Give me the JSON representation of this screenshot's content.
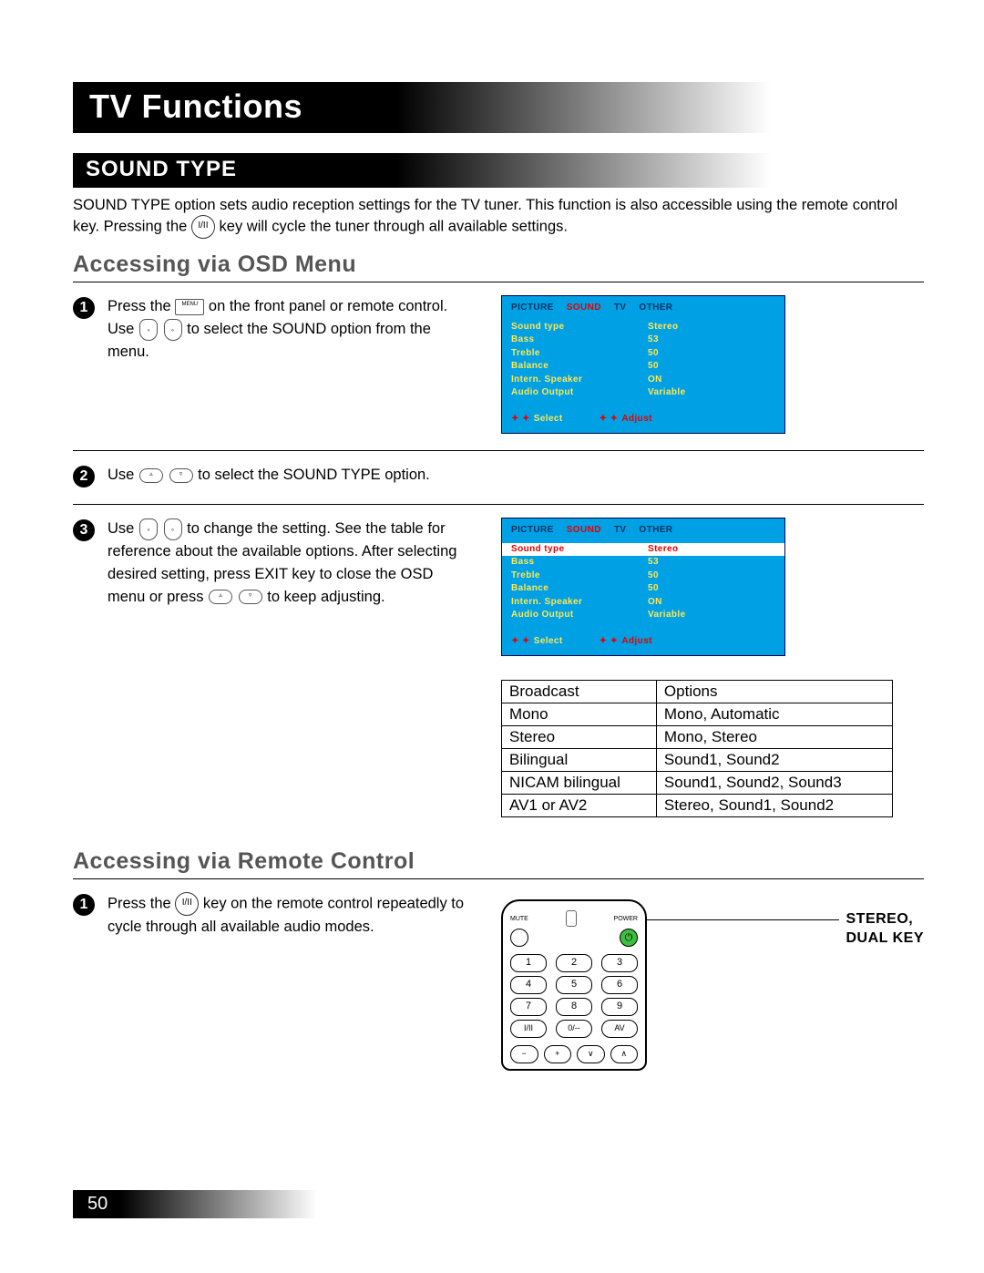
{
  "page_number": "50",
  "title": "TV Functions",
  "section": "SOUND TYPE",
  "intro_a": "SOUND TYPE option sets audio reception settings for the TV tuner.  This function is also accessible using the remote control key.  Pressing the ",
  "intro_key": "I/II",
  "intro_b": " key will cycle the tuner through all available settings.",
  "h2_osd": "Accessing via OSD Menu",
  "h2_remote": "Accessing via Remote Control",
  "steps": {
    "s1": {
      "n": "1",
      "a": "Press the ",
      "b": " on the front panel or remote control.  Use ",
      "c": " to select the SOUND option from the menu."
    },
    "s2": {
      "n": "2",
      "a": "Use ",
      "b": " to select the SOUND TYPE option."
    },
    "s3": {
      "n": "3",
      "a": "Use ",
      "b": " to change the setting.  See the table for reference about the available options.  After selecting desired setting, press EXIT key to close the OSD menu or press ",
      "c": " to keep adjusting."
    },
    "r1": {
      "n": "1",
      "a": "Press the ",
      "b": " key on the remote control repeatedly to cycle through all available audio modes."
    }
  },
  "osd": {
    "tabs": [
      "PICTURE",
      "SOUND",
      "TV",
      "OTHER"
    ],
    "active_tab": "SOUND",
    "rows": [
      {
        "k": "Sound type",
        "v": "Stereo"
      },
      {
        "k": "Bass",
        "v": "53"
      },
      {
        "k": "Treble",
        "v": "50"
      },
      {
        "k": "Balance",
        "v": "50"
      },
      {
        "k": "Intern. Speaker",
        "v": "ON"
      },
      {
        "k": "Audio Output",
        "v": "Variable"
      }
    ],
    "foot_select": "Select",
    "foot_adjust": "Adjust"
  },
  "ref_table": [
    [
      "Broadcast",
      "Options"
    ],
    [
      "Mono",
      "Mono, Automatic"
    ],
    [
      "Stereo",
      "Mono, Stereo"
    ],
    [
      "Bilingual",
      "Sound1, Sound2"
    ],
    [
      "NICAM bilingual",
      "Sound1, Sound2, Sound3"
    ],
    [
      "AV1 or AV2",
      "Stereo, Sound1, Sound2"
    ]
  ],
  "remote": {
    "mute": "MUTE",
    "power": "POWER",
    "pwr_glyph": "⏻",
    "rows": [
      [
        "1",
        "2",
        "3"
      ],
      [
        "4",
        "5",
        "6"
      ],
      [
        "7",
        "8",
        "9"
      ],
      [
        "I/II",
        "0/--",
        "AV"
      ]
    ],
    "bottom": [
      "−",
      "+",
      "∨",
      "∧"
    ],
    "caption_a": "STEREO,",
    "caption_b": "DUAL KEY"
  }
}
